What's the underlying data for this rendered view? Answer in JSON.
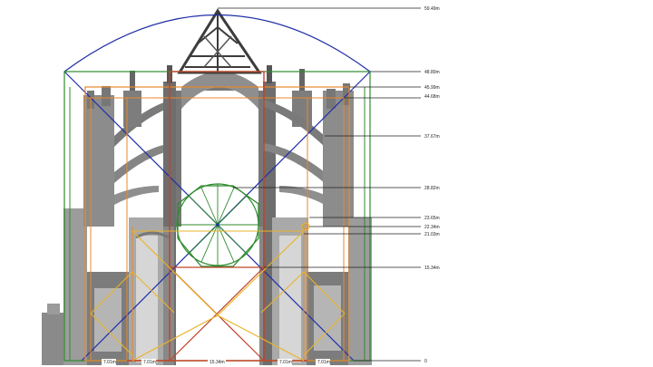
{
  "diagram": {
    "height_labels": [
      {
        "id": "h-5949",
        "text": "59.49m"
      },
      {
        "id": "h-4880",
        "text": "48.80m"
      },
      {
        "id": "h-4599",
        "text": "45.99m"
      },
      {
        "id": "h-4468",
        "text": "44.68m"
      },
      {
        "id": "h-3767",
        "text": "37.67m"
      },
      {
        "id": "h-2882",
        "text": "28.82m"
      },
      {
        "id": "h-2365",
        "text": "23.65m"
      },
      {
        "id": "h-2234",
        "text": "22.34m"
      },
      {
        "id": "h-2103",
        "text": "21.03m"
      },
      {
        "id": "h-1534",
        "text": "15.34m"
      },
      {
        "id": "h-0",
        "text": "0"
      }
    ],
    "width_labels": [
      {
        "id": "w-1",
        "text": "7.01m"
      },
      {
        "id": "w-2",
        "text": "7.01m"
      },
      {
        "id": "w-3",
        "text": "15.34m"
      },
      {
        "id": "w-4",
        "text": "7.01m"
      },
      {
        "id": "w-5",
        "text": "7.01m"
      }
    ],
    "colors": {
      "blue": "#1f2fa6",
      "green": "#2e8b2e",
      "orange": "#e8892b",
      "red": "#c0442a",
      "yellow": "#e9b429",
      "stone_dark": "#6f6f6f",
      "stone_light": "#bdbdbd"
    }
  }
}
